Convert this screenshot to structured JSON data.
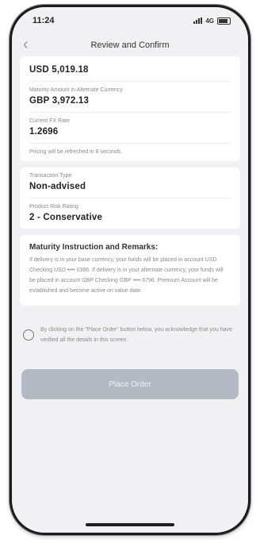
{
  "status": {
    "time": "11:24",
    "network": "4G"
  },
  "nav": {
    "title": "Review and Confirm",
    "back_glyph": "‹"
  },
  "summary": {
    "top_value": "USD 5,019.18",
    "maturity_alt_label": "Maturity Amount in Alternate Currency",
    "maturity_alt_value": "GBP 3,972.13",
    "fx_label": "Current FX Rate",
    "fx_value": "1.2696",
    "pricing_note": "Pricing will be refreshed in 8 seconds."
  },
  "transaction": {
    "type_label": "Transaction Type",
    "type_value": "Non-advised",
    "risk_label": "Product Risk Rating",
    "risk_value": "2 - Conservative"
  },
  "remarks": {
    "title": "Maturity Instruction and Remarks:",
    "body": "If delivery is in your base currency, your funds will be placed in account USD Checking USD •••• 0386. If delivery is in your alternate currency, your funds will be placed in account GBP Checking GBP •••• 6796. Premium Account will be established and become active on value date."
  },
  "consent": {
    "text": "By clicking on the \"Place Order\" button below, you acknowledge that you have verified all the details in this screen."
  },
  "actions": {
    "place_order": "Place Order"
  }
}
